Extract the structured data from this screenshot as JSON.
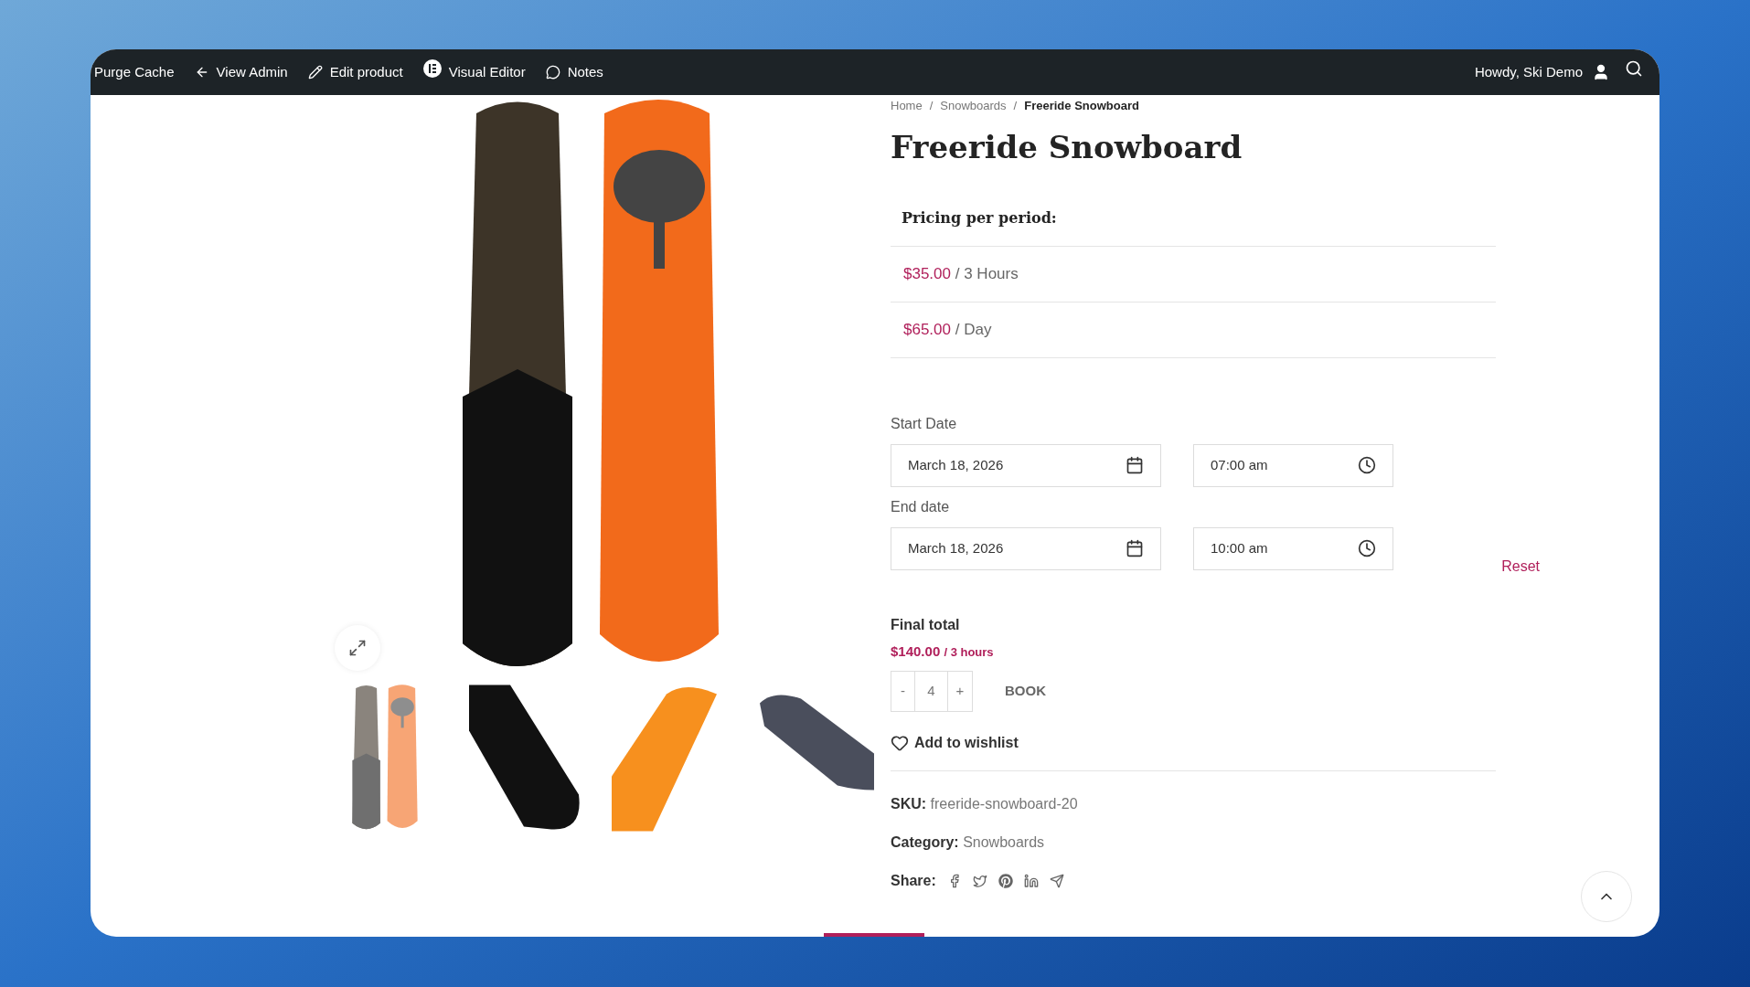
{
  "admin_bar": {
    "items": [
      {
        "label": "Purge Cache"
      },
      {
        "label": "View Admin"
      },
      {
        "label": "Edit product"
      },
      {
        "label": "Visual Editor"
      },
      {
        "label": "Notes"
      }
    ],
    "greeting": "Howdy, Ski Demo"
  },
  "breadcrumb": {
    "items": [
      "Home",
      "Snowboards",
      "Freeride Snowboard"
    ],
    "separator": "/"
  },
  "product": {
    "title": "Freeride Snowboard",
    "pricing_heading": "Pricing per period:",
    "prices": [
      {
        "amount": "$35.00",
        "period": "/ 3 Hours"
      },
      {
        "amount": "$65.00",
        "period": "/ Day"
      }
    ],
    "start": {
      "label": "Start Date",
      "date": "March 18, 2026",
      "time": "07:00 am"
    },
    "end": {
      "label": "End date",
      "date": "March 18, 2026",
      "time": "10:00 am"
    },
    "reset": "Reset",
    "total": {
      "label": "Final total",
      "amount": "$140.00",
      "period": "/ 3 hours"
    },
    "quantity": {
      "minus": "-",
      "value": "4",
      "plus": "+"
    },
    "book": "BOOK",
    "wishlist": "Add to wishlist",
    "meta": [
      {
        "label": "SKU:",
        "value": "freeride-snowboard-20"
      },
      {
        "label": "Category:",
        "value": "Snowboards"
      }
    ],
    "share": {
      "label": "Share:"
    }
  },
  "gallery": {
    "thumbnails": [
      {
        "kind": "pair"
      },
      {
        "kind": "black"
      },
      {
        "kind": "orange"
      },
      {
        "kind": "grey"
      }
    ]
  }
}
